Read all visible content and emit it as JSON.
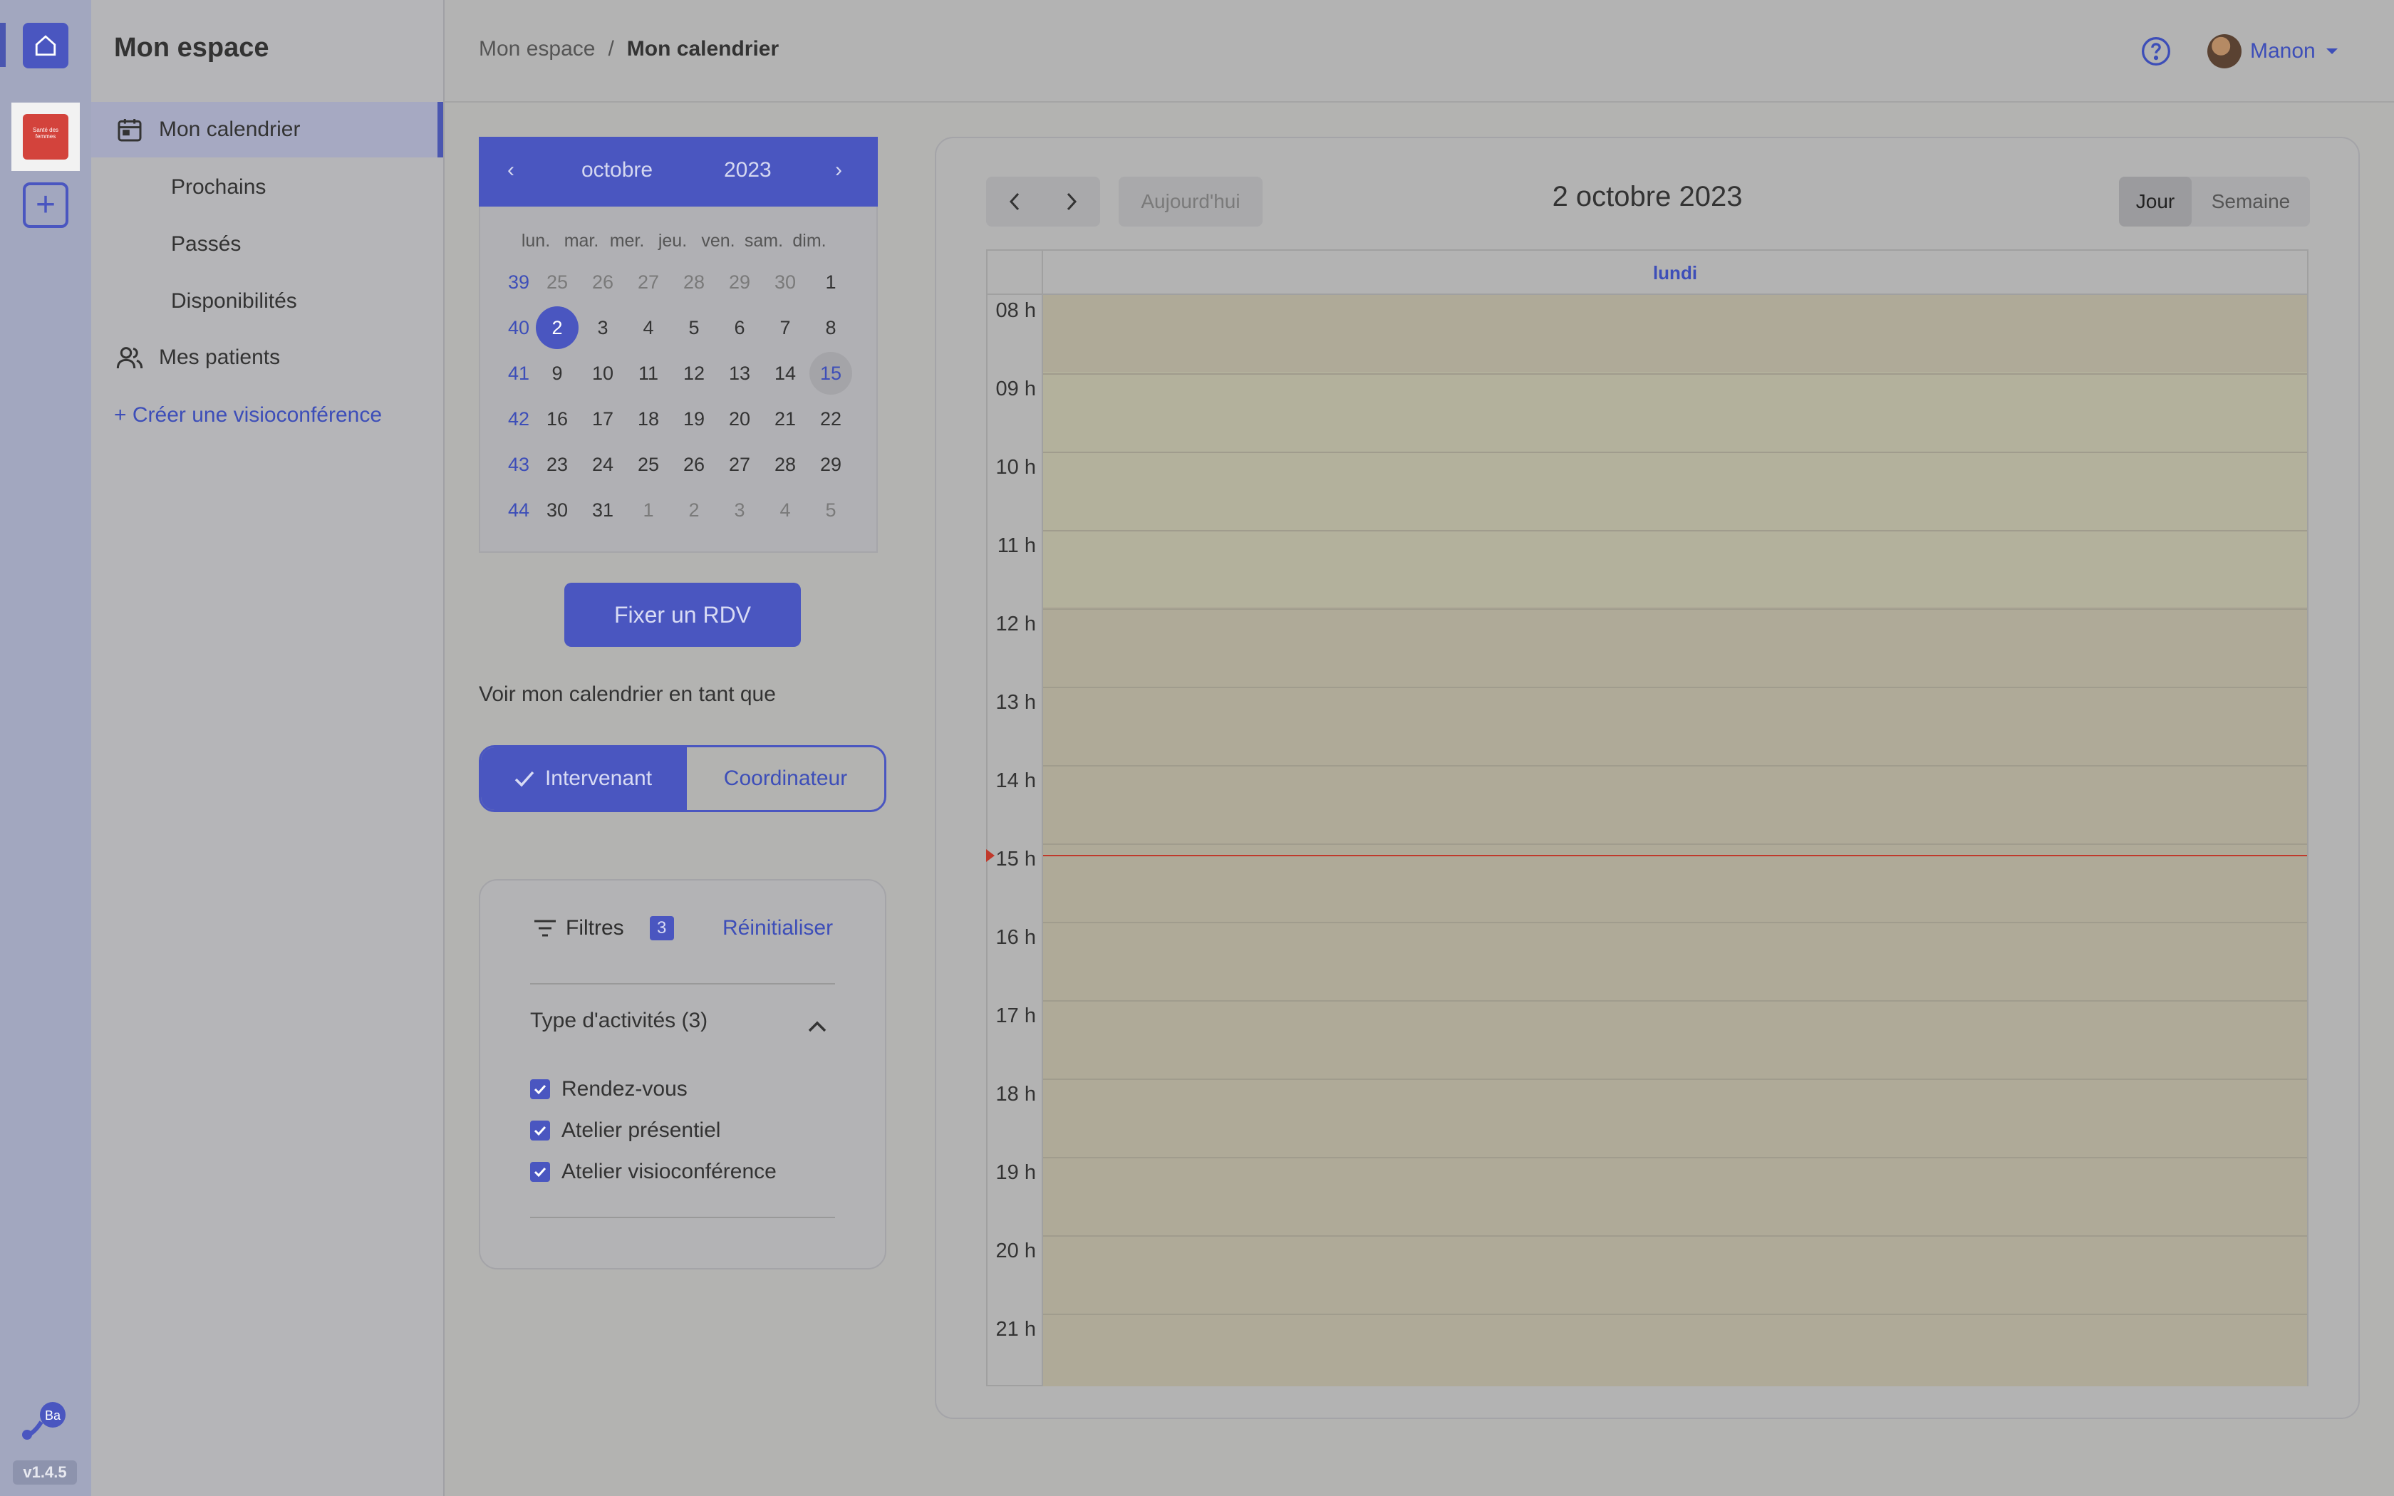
{
  "rail": {
    "org_logo_text": "Santé des femmes",
    "brand_initials": "Ba",
    "version": "v1.4.5"
  },
  "sidebar": {
    "title": "Mon espace",
    "items": [
      {
        "label": "Mon calendrier"
      },
      {
        "label": "Prochains"
      },
      {
        "label": "Passés"
      },
      {
        "label": "Disponibilités"
      },
      {
        "label": "Mes patients"
      }
    ],
    "create_link": "+ Créer une visioconférence"
  },
  "header": {
    "breadcrumb_root": "Mon espace",
    "breadcrumb_sep": "/",
    "breadcrumb_current": "Mon calendrier",
    "user_name": "Manon"
  },
  "minical": {
    "month": "octobre",
    "year": "2023",
    "prev": "‹",
    "next": "›",
    "weekdays": [
      "lun.",
      "mar.",
      "mer.",
      "jeu.",
      "ven.",
      "sam.",
      "dim."
    ],
    "weeks": [
      {
        "num": "39",
        "days": [
          "25",
          "26",
          "27",
          "28",
          "29",
          "30",
          "1"
        ]
      },
      {
        "num": "40",
        "days": [
          "2",
          "3",
          "4",
          "5",
          "6",
          "7",
          "8"
        ]
      },
      {
        "num": "41",
        "days": [
          "9",
          "10",
          "11",
          "12",
          "13",
          "14",
          "15"
        ]
      },
      {
        "num": "42",
        "days": [
          "16",
          "17",
          "18",
          "19",
          "20",
          "21",
          "22"
        ]
      },
      {
        "num": "43",
        "days": [
          "23",
          "24",
          "25",
          "26",
          "27",
          "28",
          "29"
        ]
      },
      {
        "num": "44",
        "days": [
          "30",
          "31",
          "1",
          "2",
          "3",
          "4",
          "5"
        ]
      }
    ],
    "selected": "2",
    "today": "15"
  },
  "actions": {
    "fix_rdv": "Fixer un RDV",
    "view_as_label": "Voir mon calendrier en tant que",
    "role_on": "Intervenant",
    "role_off": "Coordinateur"
  },
  "filters": {
    "title": "Filtres",
    "count": "3",
    "reset": "Réinitialiser",
    "group_label": "Type d'activités (3)",
    "options": [
      "Rendez-vous",
      "Atelier présentiel",
      "Atelier visioconférence"
    ]
  },
  "calendar": {
    "today_label": "Aujourd'hui",
    "date_title": "2 octobre 2023",
    "view_day": "Jour",
    "view_week": "Semaine",
    "day_name": "lundi",
    "hours": [
      "08 h",
      "09 h",
      "10 h",
      "11 h",
      "12 h",
      "13 h",
      "14 h",
      "15 h",
      "16 h",
      "17 h",
      "18 h",
      "19 h",
      "20 h",
      "21 h"
    ],
    "now_time": "14:37"
  },
  "colors": {
    "accent": "#4a56c0",
    "link": "#3d4eb8",
    "now_line": "#c0392b"
  }
}
